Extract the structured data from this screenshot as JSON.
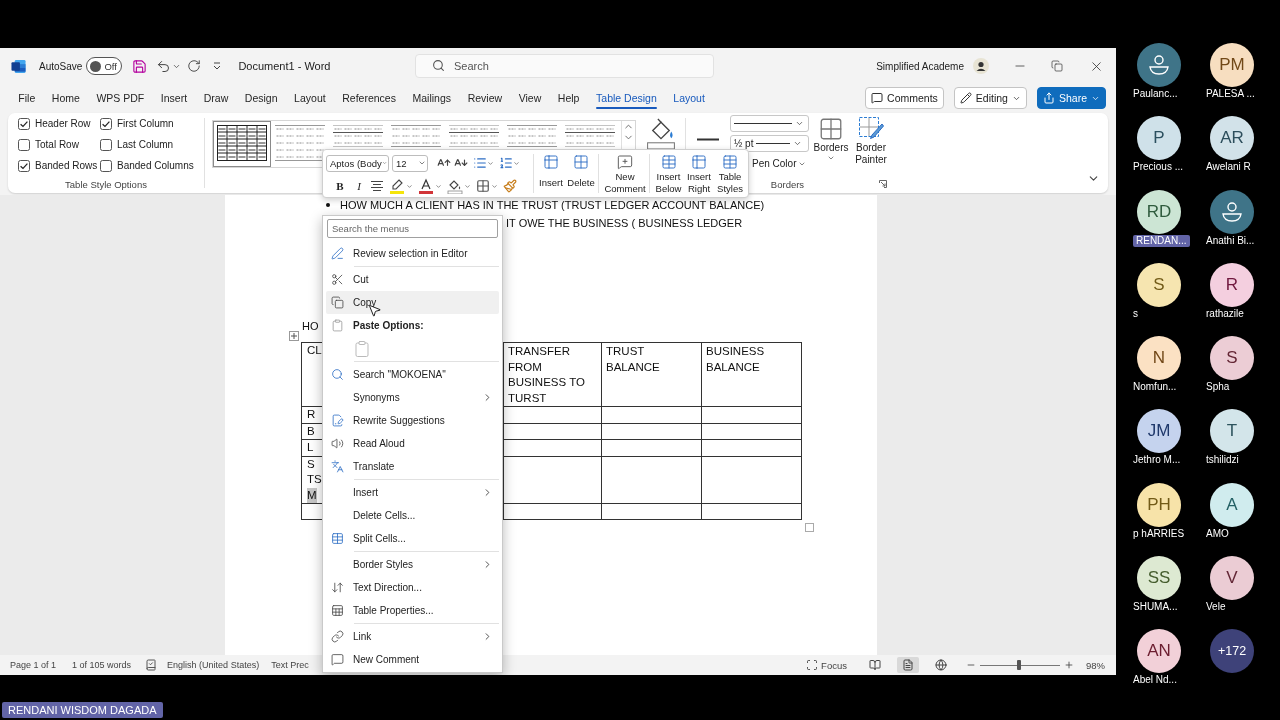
{
  "window": {
    "title": "Document1 - Word",
    "autosave": {
      "label": "AutoSave",
      "on": false,
      "state": "Off"
    },
    "search": {
      "placeholder": "Search"
    },
    "user": "Simplified Academe"
  },
  "tabs": [
    {
      "label": "File",
      "selected": false,
      "contextual": false
    },
    {
      "label": "Home",
      "selected": false,
      "contextual": false
    },
    {
      "label": "WPS PDF",
      "selected": false,
      "contextual": false
    },
    {
      "label": "Insert",
      "selected": false,
      "contextual": false
    },
    {
      "label": "Draw",
      "selected": false,
      "contextual": false
    },
    {
      "label": "Design",
      "selected": false,
      "contextual": false
    },
    {
      "label": "Layout",
      "selected": false,
      "contextual": false
    },
    {
      "label": "References",
      "selected": false,
      "contextual": false
    },
    {
      "label": "Mailings",
      "selected": false,
      "contextual": false
    },
    {
      "label": "Review",
      "selected": false,
      "contextual": false
    },
    {
      "label": "View",
      "selected": false,
      "contextual": false
    },
    {
      "label": "Help",
      "selected": false,
      "contextual": false
    },
    {
      "label": "Table Design",
      "selected": true,
      "contextual": true
    },
    {
      "label": "Layout",
      "selected": false,
      "contextual": true
    }
  ],
  "actions": {
    "comments": "Comments",
    "editing": "Editing",
    "share": "Share"
  },
  "ribbon": {
    "style_options": {
      "title": "Table Style Options",
      "options": [
        {
          "label": "Header Row",
          "checked": true
        },
        {
          "label": "First Column",
          "checked": true
        },
        {
          "label": "Total Row",
          "checked": false
        },
        {
          "label": "Last Column",
          "checked": false
        },
        {
          "label": "Banded Rows",
          "checked": true
        },
        {
          "label": "Banded Columns",
          "checked": false
        }
      ]
    },
    "table_styles": [
      {
        "selected": true
      },
      {
        "selected": false
      },
      {
        "selected": false
      },
      {
        "selected": false
      },
      {
        "selected": false
      },
      {
        "selected": false
      },
      {
        "selected": false
      }
    ],
    "borders": {
      "title": "Borders",
      "pen_weight": "½ pt",
      "pen_color": "Pen Color",
      "borders_button": "Borders",
      "painter_button": "Border Painter"
    }
  },
  "mini_toolbar": {
    "font": "Aptos (Body",
    "size": "12",
    "bold": "B",
    "italic": "I",
    "buttons": [
      "Insert",
      "Delete",
      "New Comment",
      "Insert Below",
      "Insert Right",
      "Table Styles"
    ]
  },
  "document": {
    "bullet_line": "HOW MUCH A CLIENT HAS IN THE TRUST (TRUST LEDGER ACCOUNT BALANCE)",
    "line_2": "IT OWE THE BUSINESS ( BUSINESS LEDGER",
    "line_3": "HO",
    "table": {
      "header": [
        "CL",
        "TRANSFER FROM BUSINESS TO TURST",
        "TRUST BALANCE",
        "BUSINESS BALANCE"
      ],
      "rows": [
        {
          "kind": "text",
          "lines": [
            {
              "text": "R",
              "selected": false
            }
          ]
        },
        {
          "kind": "text",
          "lines": [
            {
              "text": "B",
              "selected": false
            }
          ]
        },
        {
          "kind": "text",
          "lines": [
            {
              "text": "L",
              "selected": false
            }
          ]
        },
        {
          "kind": "text",
          "lines": [
            {
              "text": "S",
              "selected": false
            },
            {
              "text": "TS",
              "selected": false
            },
            {
              "text": "M",
              "selected": true
            }
          ]
        },
        {
          "kind": "blank"
        }
      ]
    }
  },
  "context_menu": {
    "search": {
      "placeholder": "Search the menus"
    },
    "groups": [
      [
        {
          "kind": "item",
          "label": "Review selection in Editor",
          "submenu": false,
          "hovered": false
        }
      ],
      [
        {
          "kind": "item",
          "label": "Cut",
          "submenu": false,
          "hovered": false
        },
        {
          "kind": "item",
          "label": "Copy",
          "submenu": false,
          "hovered": true
        },
        {
          "kind": "heading",
          "label": "Paste Options:",
          "submenu": false,
          "hovered": false
        },
        {
          "kind": "paste_buttons",
          "submenu": false,
          "hovered": false
        }
      ],
      [
        {
          "kind": "item",
          "label": "Search \"MOKOENA\"",
          "submenu": false,
          "hovered": false
        },
        {
          "kind": "item",
          "label": "Synonyms",
          "submenu": true,
          "hovered": false
        },
        {
          "kind": "item",
          "label": "Rewrite Suggestions",
          "submenu": false,
          "hovered": false
        },
        {
          "kind": "item",
          "label": "Read Aloud",
          "submenu": false,
          "hovered": false
        },
        {
          "kind": "item",
          "label": "Translate",
          "submenu": false,
          "hovered": false
        }
      ],
      [
        {
          "kind": "item",
          "label": "Insert",
          "submenu": true,
          "hovered": false
        },
        {
          "kind": "item",
          "label": "Delete Cells...",
          "submenu": false,
          "hovered": false
        },
        {
          "kind": "item",
          "label": "Split Cells...",
          "submenu": false,
          "hovered": false
        }
      ],
      [
        {
          "kind": "item",
          "label": "Border Styles",
          "submenu": true,
          "hovered": false
        },
        {
          "kind": "item",
          "label": "Text Direction...",
          "submenu": false,
          "hovered": false
        },
        {
          "kind": "item",
          "label": "Table Properties...",
          "submenu": false,
          "hovered": false
        }
      ],
      [
        {
          "kind": "item",
          "label": "Link",
          "submenu": true,
          "hovered": false
        },
        {
          "kind": "item",
          "label": "New Comment",
          "submenu": false,
          "hovered": false
        }
      ]
    ]
  },
  "status_bar": {
    "page": "Page 1 of 1",
    "words": "1 of 105 words",
    "language": "English (United States)",
    "predictions": "Text Prec",
    "focus": "Focus",
    "views": [
      {
        "selected": false
      },
      {
        "selected": true
      },
      {
        "selected": false
      }
    ],
    "zoom": {
      "level": 0.49,
      "reading": "98%"
    }
  },
  "participant_rows": [
    [
      {
        "kind": "silhouette",
        "name": "Paulanc...",
        "color": "#3f7488",
        "highlighted": false
      },
      {
        "kind": "initials",
        "name": "PALESA ...",
        "initials": "PM",
        "color": "#f7dec0",
        "highlighted": false
      }
    ],
    [
      {
        "kind": "initials",
        "name": "Precious ...",
        "initials": "P",
        "color": "#cfe1e9",
        "highlighted": false
      },
      {
        "kind": "initials",
        "name": "Awelani R",
        "initials": "AR",
        "color": "#d2e2e9",
        "highlighted": false
      }
    ],
    [
      {
        "kind": "initials",
        "name": "RENDAN...",
        "initials": "RD",
        "color": "#cce5d4",
        "highlighted": true
      },
      {
        "kind": "silhouette",
        "name": "Anathi Bi...",
        "color": "#3f7488",
        "highlighted": false
      }
    ],
    [
      {
        "kind": "initials",
        "name": "s",
        "initials": "S",
        "color": "#f6e5b0",
        "highlighted": false
      },
      {
        "kind": "initials",
        "name": "rathazile",
        "initials": "R",
        "color": "#f4cfdf",
        "highlighted": false
      }
    ],
    [
      {
        "kind": "initials",
        "name": "Nomfun...",
        "initials": "N",
        "color": "#fbe1c3",
        "highlighted": false
      },
      {
        "kind": "initials",
        "name": "Spha",
        "initials": "S",
        "color": "#eccdd5",
        "highlighted": false
      }
    ],
    [
      {
        "kind": "initials",
        "name": "Jethro M...",
        "initials": "JM",
        "color": "#c5d3ee",
        "highlighted": false
      },
      {
        "kind": "initials",
        "name": "tshilidzi",
        "initials": "T",
        "color": "#d3e5ea",
        "highlighted": false
      }
    ],
    [
      {
        "kind": "initials",
        "name": "p hARRIES",
        "initials": "PH",
        "color": "#f7e3a9",
        "highlighted": false
      },
      {
        "kind": "initials",
        "name": "AMO",
        "initials": "A",
        "color": "#d0ecee",
        "highlighted": false
      }
    ],
    [
      {
        "kind": "initials",
        "name": "SHUMA...",
        "initials": "SS",
        "color": "#dde9d2",
        "highlighted": false
      },
      {
        "kind": "initials",
        "name": "Vele",
        "initials": "V",
        "color": "#ebccd4",
        "highlighted": false
      }
    ],
    [
      {
        "kind": "initials",
        "name": "Abel Nd...",
        "initials": "AN",
        "color": "#f2d0d8",
        "highlighted": false
      },
      {
        "kind": "overflow",
        "count": "+172",
        "color": "#3e4279"
      }
    ]
  ],
  "name_tag": "RENDANI WISDOM DAGADA"
}
